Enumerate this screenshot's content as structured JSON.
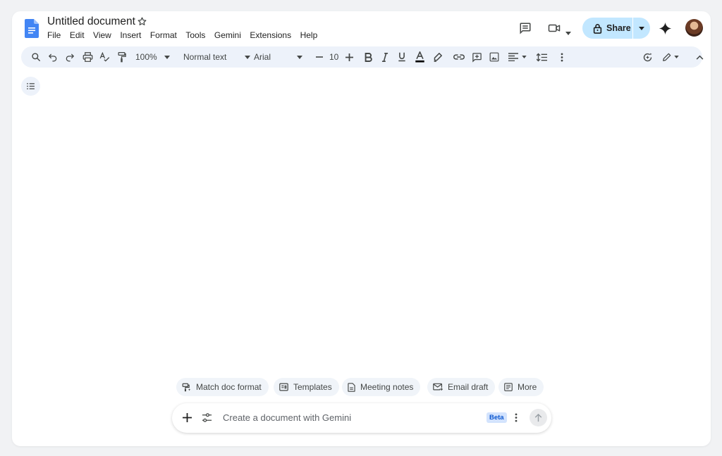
{
  "doc": {
    "title": "Untitled document"
  },
  "menu": [
    "File",
    "Edit",
    "View",
    "Insert",
    "Format",
    "Tools",
    "Gemini",
    "Extensions",
    "Help"
  ],
  "share": {
    "label": "Share"
  },
  "toolbar": {
    "zoom": "100%",
    "style": "Normal text",
    "font": "Arial",
    "font_size": "10"
  },
  "chips": [
    "Match doc format",
    "Templates",
    "Meeting notes",
    "Email draft",
    "More"
  ],
  "gemini": {
    "placeholder": "Create a document with Gemini",
    "badge": "Beta"
  },
  "colors": {
    "accent": "#c2e7ff",
    "toolbar_bg": "#edf2fa",
    "doc_blue": "#4285f4",
    "badge_text": "#0b57d0"
  },
  "icons": [
    "docs-logo-icon",
    "star-icon",
    "comment-icon",
    "video-call-icon",
    "lock-icon",
    "gemini-sparkle-icon",
    "search-icon",
    "undo-icon",
    "redo-icon",
    "print-icon",
    "spellcheck-icon",
    "paint-format-icon",
    "bold-icon",
    "italic-icon",
    "underline-icon",
    "text-color-icon",
    "highlight-icon",
    "link-icon",
    "add-comment-icon",
    "image-icon",
    "align-icon",
    "line-spacing-icon",
    "more-vert-icon",
    "gemini-refine-icon",
    "editing-mode-icon",
    "collapse-icon",
    "outline-icon",
    "plus-icon",
    "settings-sliders-icon",
    "send-arrow-icon"
  ]
}
